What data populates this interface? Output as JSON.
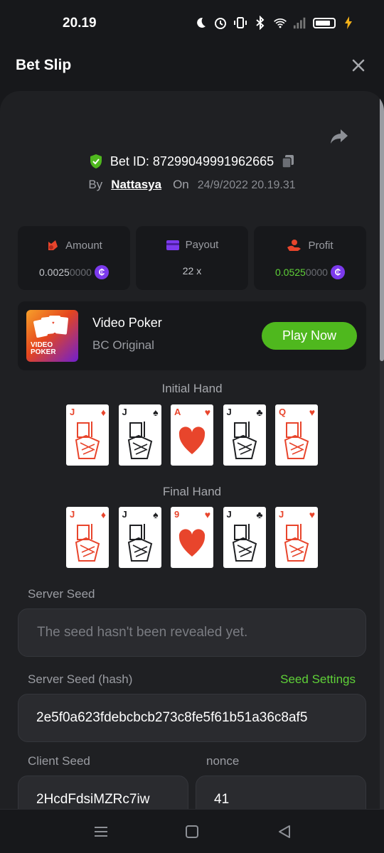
{
  "status": {
    "time": "20.19"
  },
  "header": {
    "title": "Bet Slip"
  },
  "bet": {
    "id_label": "Bet ID:",
    "id": "87299049991962665",
    "by_label": "By",
    "user": "Nattasya",
    "on_label": "On",
    "date": "24/9/2022 20.19.31"
  },
  "stats": {
    "amount": {
      "label": "Amount",
      "value_main": "0.0025",
      "value_dim": "0000"
    },
    "payout": {
      "label": "Payout",
      "value": "22 x"
    },
    "profit": {
      "label": "Profit",
      "value_main": "0.0525",
      "value_dim": "0000"
    }
  },
  "game": {
    "name": "Video Poker",
    "provider": "BC Original",
    "play_label": "Play Now",
    "thumb_text_1": "VIDEO",
    "thumb_text_2": "POKER"
  },
  "initial_hand": {
    "title": "Initial Hand",
    "cards": [
      {
        "rank": "J",
        "suit": "♦",
        "color": "#e8452c"
      },
      {
        "rank": "J",
        "suit": "♠",
        "color": "#1f2023"
      },
      {
        "rank": "A",
        "suit": "♥",
        "color": "#e8452c"
      },
      {
        "rank": "J",
        "suit": "♣",
        "color": "#1f2023"
      },
      {
        "rank": "Q",
        "suit": "♥",
        "color": "#e8452c"
      }
    ]
  },
  "final_hand": {
    "title": "Final Hand",
    "cards": [
      {
        "rank": "J",
        "suit": "♦",
        "color": "#e8452c"
      },
      {
        "rank": "J",
        "suit": "♠",
        "color": "#1f2023"
      },
      {
        "rank": "9",
        "suit": "♥",
        "color": "#e8452c"
      },
      {
        "rank": "J",
        "suit": "♣",
        "color": "#1f2023"
      },
      {
        "rank": "J",
        "suit": "♥",
        "color": "#e8452c"
      }
    ]
  },
  "seeds": {
    "server_label": "Server Seed",
    "server_value": "The seed hasn't been revealed yet.",
    "hash_label": "Server Seed (hash)",
    "settings_label": "Seed Settings",
    "hash_value": "2e5f0a623fdebcbcb273c8fe5f61b51a36c8af5",
    "client_label": "Client Seed",
    "client_value": "2HcdFdsiMZRc7iw",
    "nonce_label": "nonce",
    "nonce_value": "41"
  },
  "colors": {
    "accent_green": "#4fb81e",
    "coin_purple": "#7c3aed",
    "profit_green": "#5fd138"
  }
}
